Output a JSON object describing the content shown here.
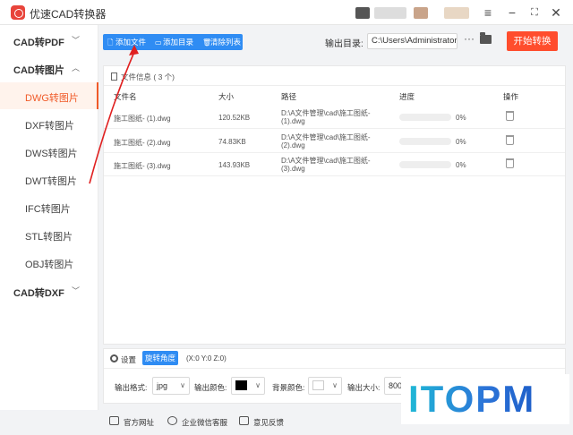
{
  "app": {
    "title": "优速CAD转换器",
    "accent": "#f05a28",
    "primary_blue": "#2f8cf3",
    "start_color": "#ff4d2d"
  },
  "window": {
    "menu_icon": "hamburger-icon",
    "minimize_icon": "minimize-icon",
    "maximize_icon": "maximize-icon",
    "close_icon": "close-icon"
  },
  "sidebar": {
    "groups": [
      {
        "label": "CAD转PDF",
        "expanded": false
      },
      {
        "label": "CAD转图片",
        "expanded": true
      },
      {
        "label": "CAD转DXF",
        "expanded": false
      }
    ],
    "items": [
      {
        "label": "DWG转图片",
        "active": true
      },
      {
        "label": "DXF转图片",
        "active": false
      },
      {
        "label": "DWS转图片",
        "active": false
      },
      {
        "label": "DWT转图片",
        "active": false
      },
      {
        "label": "IFC转图片",
        "active": false
      },
      {
        "label": "STL转图片",
        "active": false
      },
      {
        "label": "OBJ转图片",
        "active": false
      }
    ]
  },
  "toolbar": {
    "add_file": "添加文件",
    "add_dir": "添加目录",
    "clear_list": "清除列表",
    "output_label": "输出目录:",
    "output_path": "C:\\Users\\Administrator\\",
    "more": "···",
    "start": "开始转换"
  },
  "filelist": {
    "title": "文件信息",
    "count": "( 3 个)",
    "columns": [
      "文件名",
      "大小",
      "路径",
      "进度",
      "操作"
    ],
    "rows": [
      {
        "name": "施工图纸- (1).dwg",
        "size": "120.52KB",
        "path1": "D:\\A文件管理\\cad\\施工图纸-",
        "path2": "(1).dwg",
        "progress": 0,
        "progress_text": "0%"
      },
      {
        "name": "施工图纸- (2).dwg",
        "size": "74.83KB",
        "path1": "D:\\A文件管理\\cad\\施工图纸-",
        "path2": "(2).dwg",
        "progress": 0,
        "progress_text": "0%"
      },
      {
        "name": "施工图纸- (3).dwg",
        "size": "143.93KB",
        "path1": "D:\\A文件管理\\cad\\施工图纸-",
        "path2": "(3).dwg",
        "progress": 0,
        "progress_text": "0%"
      }
    ]
  },
  "settings": {
    "label": "设置",
    "rotate_btn": "旋转角度",
    "coords": "(X:0 Y:0 Z:0)",
    "format_label": "输出格式:",
    "format_value": "jpg",
    "color_label": "输出颜色:",
    "color_value": "#000000",
    "bg_label": "背景颜色:",
    "bg_value": "#ffffff",
    "size_label": "输出大小:",
    "size_value": "800"
  },
  "footer": {
    "website": "官方网址",
    "wechat": "企业微信客服",
    "feedback": "意见反馈"
  },
  "watermark": {
    "text": "ITOPM"
  }
}
